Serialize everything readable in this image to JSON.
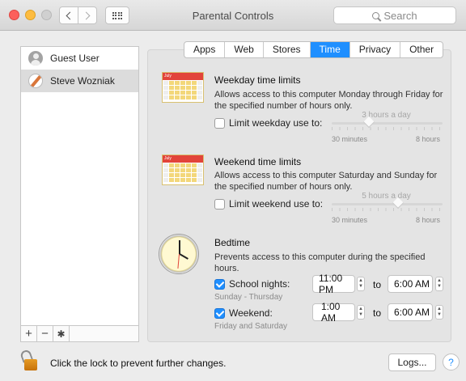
{
  "window": {
    "title": "Parental Controls"
  },
  "search": {
    "placeholder": "Search"
  },
  "users": [
    {
      "name": "Guest User",
      "icon": "guest-user-icon"
    },
    {
      "name": "Steve Wozniak",
      "icon": "baseball-avatar-icon",
      "selected": true
    }
  ],
  "sidebar_tools": {
    "add": "+",
    "remove": "−",
    "settings": "✱"
  },
  "tabs": [
    "Apps",
    "Web",
    "Stores",
    "Time",
    "Privacy",
    "Other"
  ],
  "active_tab": "Time",
  "weekday": {
    "cal_month": "July",
    "title": "Weekday time limits",
    "description": "Allows access to this computer Monday through Friday for the specified number of hours only.",
    "checkbox_label": "Limit weekday use to:",
    "checked": false,
    "slider_value_label": "3 hours a day",
    "slider_value_hours": 3,
    "min_label": "30 minutes",
    "max_label": "8 hours"
  },
  "weekend": {
    "cal_month": "July",
    "title": "Weekend time limits",
    "description": "Allows access to this computer Saturday and Sunday for the specified number of hours only.",
    "checkbox_label": "Limit weekend use to:",
    "checked": false,
    "slider_value_label": "5 hours a day",
    "slider_value_hours": 5,
    "min_label": "30 minutes",
    "max_label": "8 hours"
  },
  "bedtime": {
    "title": "Bedtime",
    "description": "Prevents access to this computer during the specified hours.",
    "school_nights": {
      "label": "School nights:",
      "checked": true,
      "sublabel": "Sunday - Thursday",
      "from": "11:00 PM",
      "to": "6:00 AM"
    },
    "weekend": {
      "label": "Weekend:",
      "checked": true,
      "sublabel": "Friday and Saturday",
      "from": "1:00 AM",
      "to": "6:00 AM"
    },
    "to_label": "to"
  },
  "footer": {
    "lock_text": "Click the lock to prevent further changes.",
    "logs_button": "Logs...",
    "help": "?"
  },
  "colors": {
    "accent": "#1f8fff",
    "close": "#fc605c",
    "minimize": "#fdbc40"
  }
}
